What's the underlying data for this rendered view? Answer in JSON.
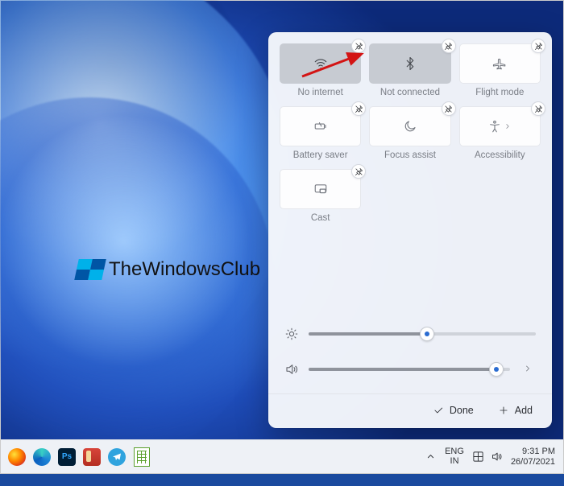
{
  "watermark": {
    "text": "TheWindowsClub"
  },
  "quick_settings": {
    "tiles": [
      {
        "id": "wifi",
        "label": "No internet",
        "active": true
      },
      {
        "id": "bluetooth",
        "label": "Not connected",
        "active": true
      },
      {
        "id": "flightmode",
        "label": "Flight mode",
        "active": false
      },
      {
        "id": "battery-saver",
        "label": "Battery saver",
        "active": false
      },
      {
        "id": "focus-assist",
        "label": "Focus assist",
        "active": false
      },
      {
        "id": "accessibility",
        "label": "Accessibility",
        "active": false
      },
      {
        "id": "cast",
        "label": "Cast",
        "active": false
      }
    ],
    "brightness_pct": 52,
    "volume_pct": 93,
    "done_label": "Done",
    "add_label": "Add"
  },
  "taskbar": {
    "language": {
      "line1": "ENG",
      "line2": "IN"
    },
    "clock": {
      "time": "9:31 PM",
      "date": "26/07/2021"
    }
  }
}
